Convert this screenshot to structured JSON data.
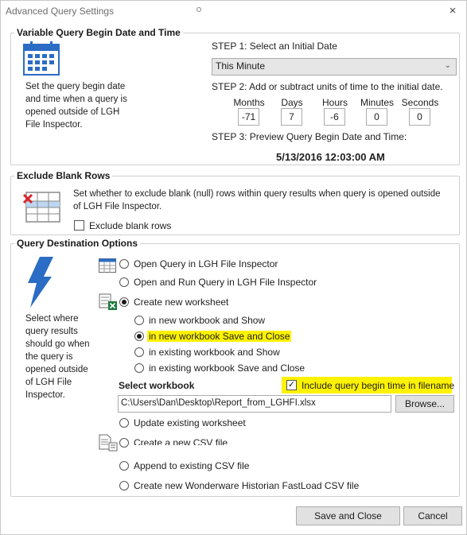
{
  "window": {
    "title": "Advanced Query Settings",
    "close_glyph": "×"
  },
  "variable_query": {
    "legend": "Variable Query Begin Date and Time",
    "icon": "calendar-icon",
    "description_lines": [
      "Set the query begin date",
      "and time when a query is",
      "opened outside of LGH",
      "File Inspector."
    ],
    "step1_label": "STEP 1: Select an Initial Date",
    "initial_date_value": "This Minute",
    "step2_label": "STEP 2: Add or subtract units of time to the initial date.",
    "units": [
      {
        "label": "Months",
        "value": "-71"
      },
      {
        "label": "Days",
        "value": "7"
      },
      {
        "label": "Hours",
        "value": "-6"
      },
      {
        "label": "Minutes",
        "value": "0"
      },
      {
        "label": "Seconds",
        "value": "0"
      }
    ],
    "step3_label": "STEP 3: Preview Query Begin Date and Time:",
    "preview_value": "5/13/2016 12:03:00 AM"
  },
  "exclude_blank": {
    "legend": "Exclude Blank Rows",
    "icon": "table-delete-icon",
    "description_lines": [
      "Set whether to exclude blank (null) rows within query results when query is opened outside",
      "of LGH File Inspector."
    ],
    "checkbox_label": "Exclude blank rows",
    "checked": false
  },
  "destination": {
    "legend": "Query Destination Options",
    "icon": "lightning-icon",
    "description_lines": [
      "Select where",
      "query results",
      "should go when",
      "the query is",
      "opened outside",
      "of LGH File",
      "Inspector."
    ],
    "options": {
      "open_query": "Open Query in LGH File Inspector",
      "open_run_query": "Open and Run Query in LGH File Inspector",
      "create_worksheet": "Create new worksheet",
      "new_wb_show": "in new workbook and Show",
      "new_wb_save_close": "in new workbook Save and Close",
      "existing_wb_show": "in existing workbook and Show",
      "existing_wb_save_close": "in existing workbook Save and Close",
      "update_worksheet": "Update existing worksheet",
      "create_csv": "Create a new CSV file",
      "append_csv": "Append to existing CSV file",
      "fastload_csv": "Create new Wonderware Historian FastLoad CSV file"
    },
    "select_workbook_label": "Select workbook",
    "include_time_label": "Include query begin time in filename",
    "include_time_checked": true,
    "workbook_path": "C:\\Users\\Dan\\Desktop\\Report_from_LGHFI.xlsx",
    "browse_label": "Browse..."
  },
  "footer": {
    "save_close_label": "Save and Close",
    "cancel_label": "Cancel"
  },
  "colors": {
    "highlight": "#fff200",
    "icon_blue": "#2b6cc4",
    "icon_red": "#d9262c",
    "icon_green": "#1d7a3d"
  }
}
